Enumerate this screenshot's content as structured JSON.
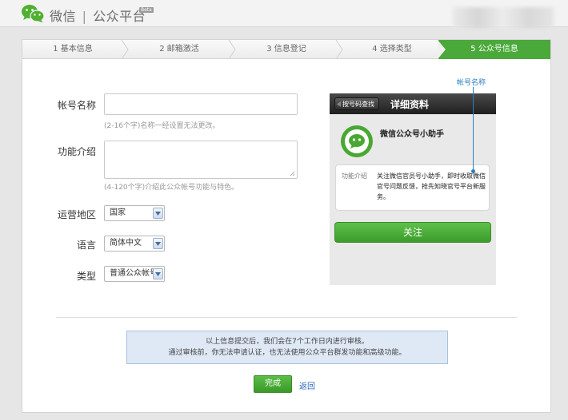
{
  "header": {
    "brand_name": "微信",
    "separator": "|",
    "brand_product": "公众平台",
    "beta_badge": "Beta"
  },
  "steps": [
    {
      "label": "1 基本信息",
      "active": false
    },
    {
      "label": "2 邮箱激活",
      "active": false
    },
    {
      "label": "3 信息登记",
      "active": false
    },
    {
      "label": "4 选择类型",
      "active": false
    },
    {
      "label": "5 公众号信息",
      "active": true
    }
  ],
  "form": {
    "account_name": {
      "label": "帐号名称",
      "value": "",
      "hint": "(2-16个字)名称一经设置无法更改。"
    },
    "intro": {
      "label": "功能介绍",
      "value": "",
      "hint": "(4-120个字)介绍此公众帐号功能与特色。"
    },
    "region": {
      "label": "运营地区",
      "selected": "国家"
    },
    "language": {
      "label": "语言",
      "selected": "简体中文"
    },
    "type": {
      "label": "类型",
      "selected": "普通公众帐号"
    }
  },
  "preview": {
    "back_button": "按号码查找",
    "title": "详细资料",
    "account_name": "微信公众号小助手",
    "desc_label": "功能介绍",
    "desc_text": "关注微信官员号小助手，即时收取微信官号问题反馈，抢先知晓官号平台新服务。",
    "follow_button": "关注",
    "callout_label": "帐号名称"
  },
  "notice": {
    "line1": "以上信息提交后，我们会在7个工作日内进行审核。",
    "line2": "通过审核前，你无法申请认证，也无法使用公众平台群发功能和高级功能。"
  },
  "actions": {
    "done": "完成",
    "back": "返回"
  },
  "colors": {
    "brand_green": "#4aa93a",
    "link_blue": "#2a66b8",
    "callout_blue": "#2a7fc2",
    "notice_bg": "#dfe9f6"
  }
}
